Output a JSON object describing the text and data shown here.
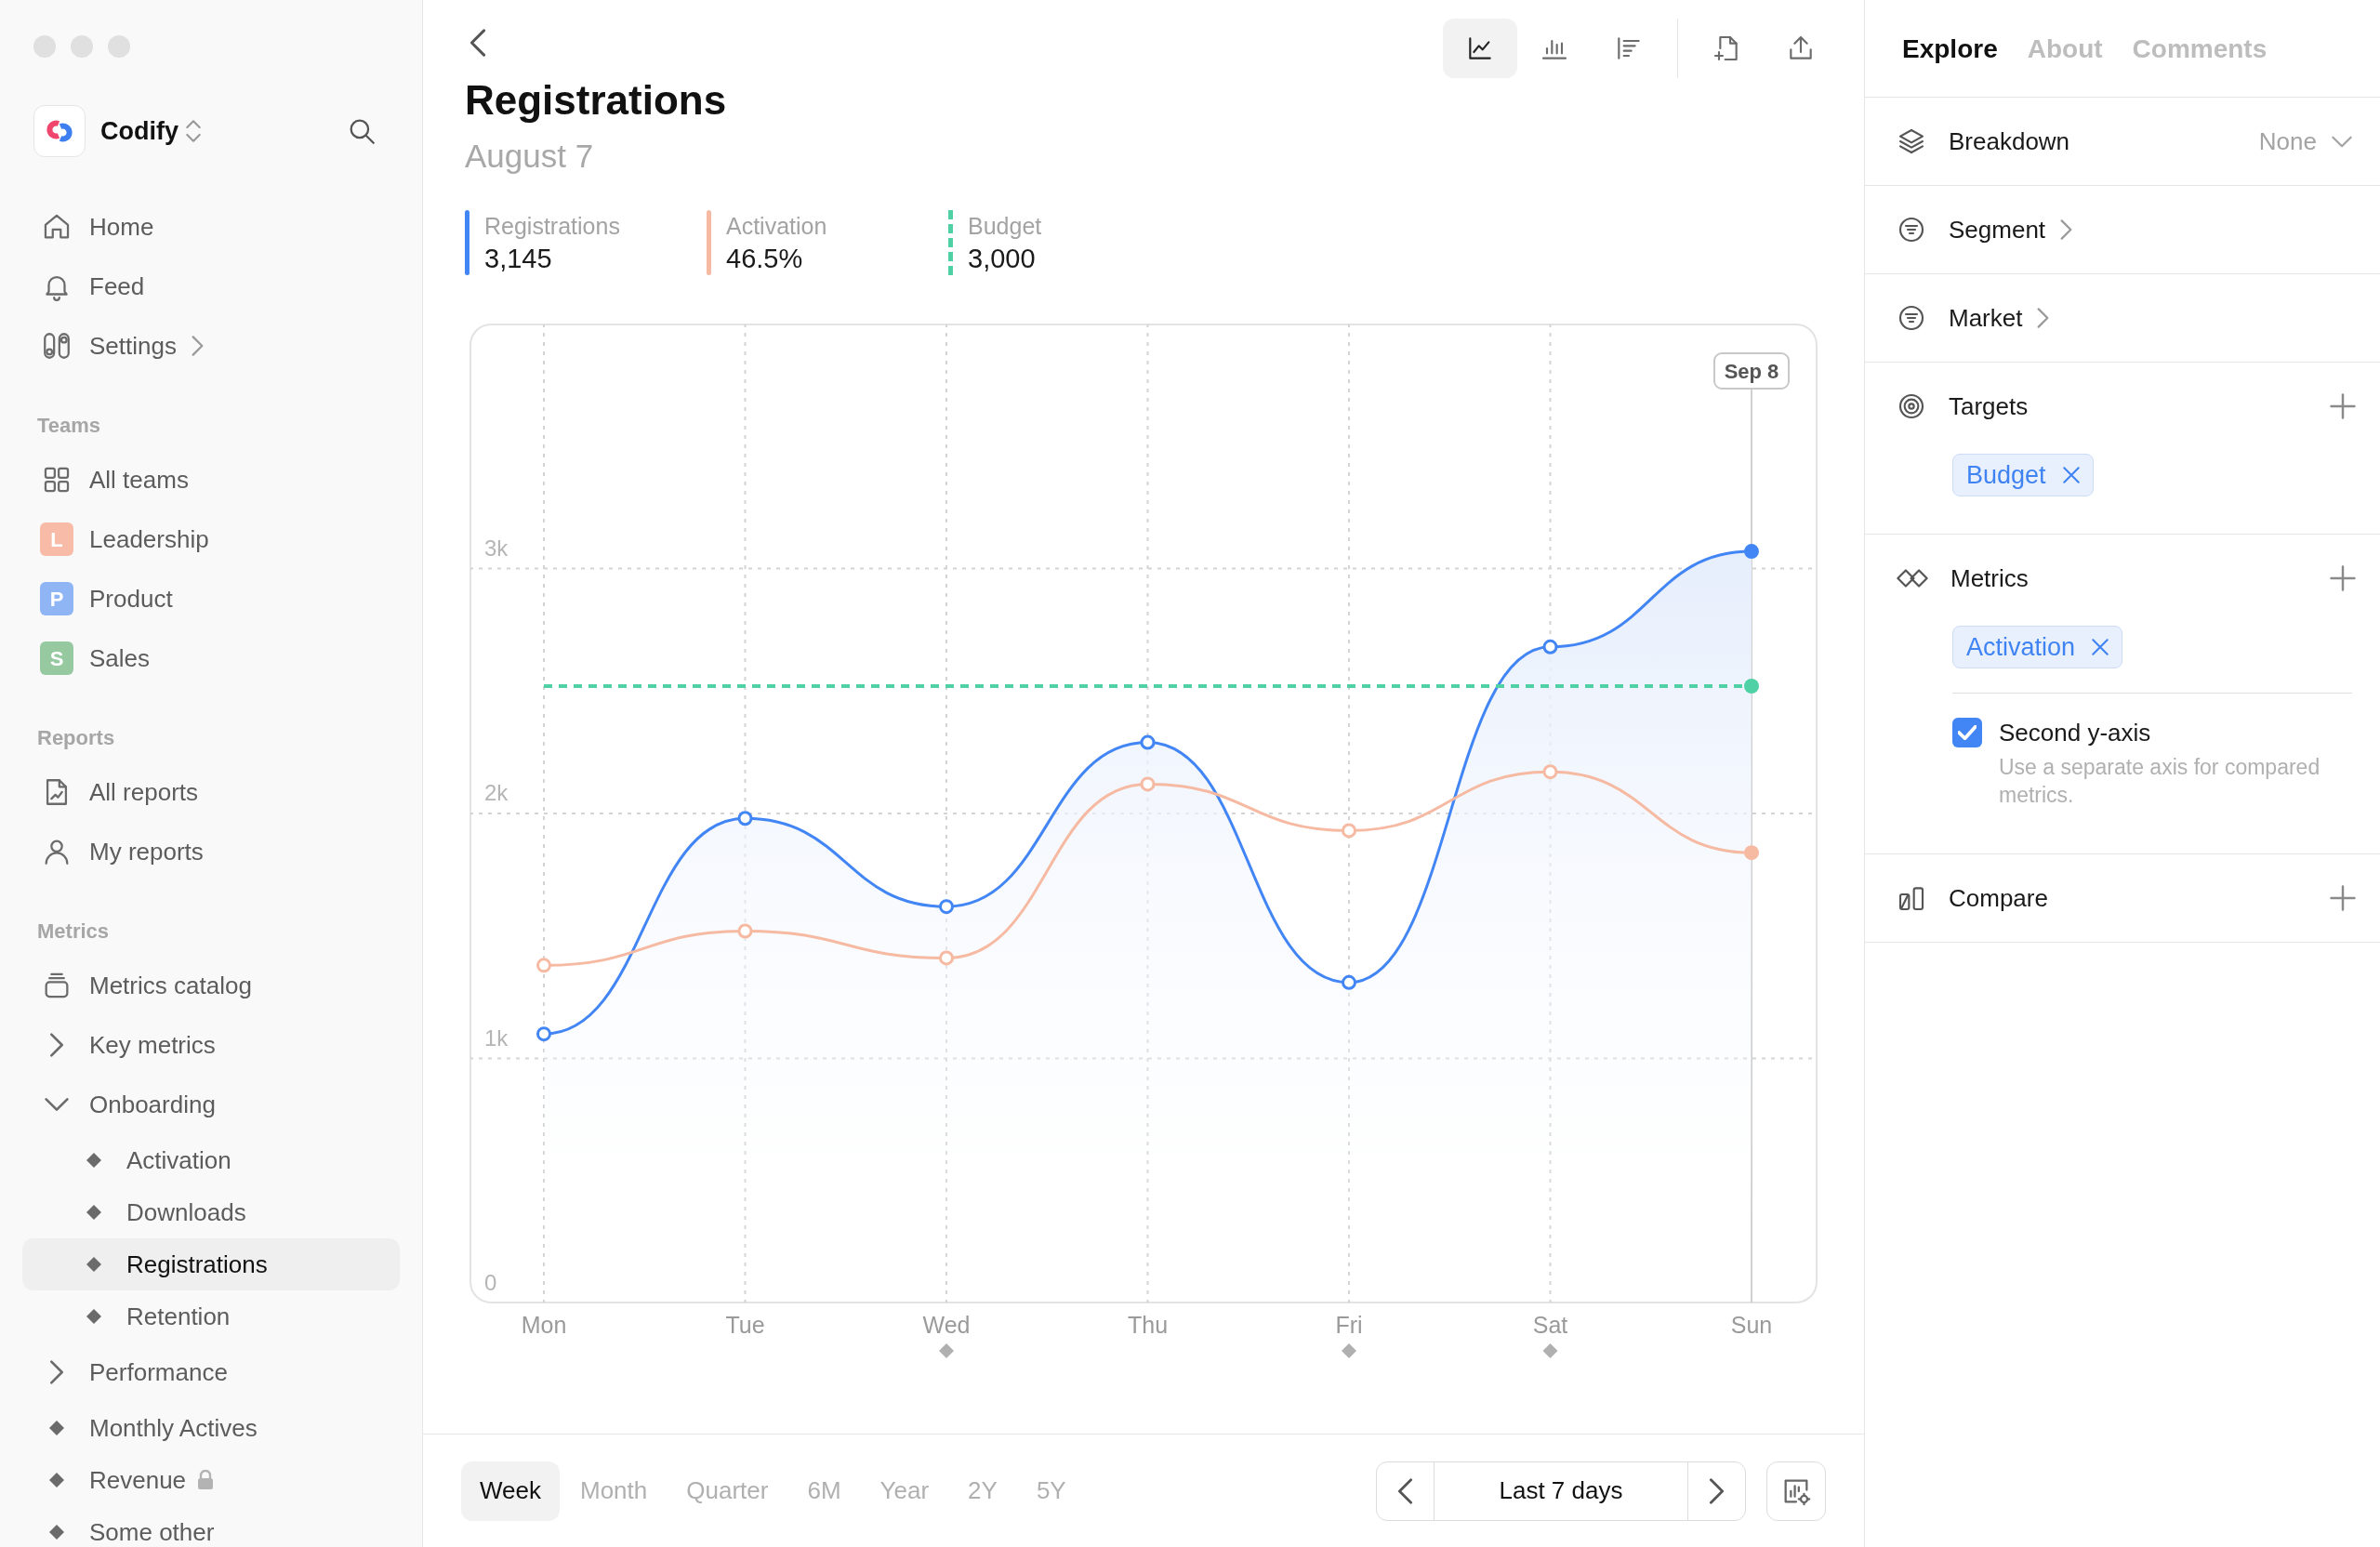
{
  "sidebar": {
    "workspace": {
      "name": "Codify"
    },
    "nav": [
      {
        "label": "Home",
        "kind": "link",
        "selected": false
      },
      {
        "label": "Feed",
        "kind": "link",
        "selected": false
      },
      {
        "label": "Settings",
        "kind": "submenu",
        "selected": false
      }
    ],
    "sections": [
      {
        "title": "Teams",
        "items": [
          {
            "label": "All teams",
            "kind": "link",
            "selected": false
          },
          {
            "label": "Leadership",
            "kind": "team",
            "initial": "L",
            "color": "#f7bba7",
            "selected": false
          },
          {
            "label": "Product",
            "kind": "team",
            "initial": "P",
            "color": "#8fb5f5",
            "selected": false
          },
          {
            "label": "Sales",
            "kind": "team",
            "initial": "S",
            "color": "#96c9a0",
            "selected": false
          }
        ]
      },
      {
        "title": "Reports",
        "items": [
          {
            "label": "All reports",
            "kind": "link",
            "selected": false
          },
          {
            "label": "My reports",
            "kind": "link",
            "selected": false
          }
        ]
      },
      {
        "title": "Metrics",
        "items": [
          {
            "label": "Metrics catalog",
            "kind": "link",
            "selected": false
          },
          {
            "label": "Key metrics",
            "kind": "group",
            "expanded": false,
            "selected": false
          },
          {
            "label": "Onboarding",
            "kind": "group",
            "expanded": true,
            "selected": false,
            "children": [
              {
                "label": "Activation",
                "kind": "metric",
                "selected": false
              },
              {
                "label": "Downloads",
                "kind": "metric",
                "selected": false
              },
              {
                "label": "Registrations",
                "kind": "metric",
                "selected": true
              },
              {
                "label": "Retention",
                "kind": "metric",
                "selected": false
              }
            ]
          },
          {
            "label": "Performance",
            "kind": "group",
            "expanded": false,
            "selected": false
          },
          {
            "label": "Monthly Actives",
            "kind": "metric",
            "selected": false
          },
          {
            "label": "Revenue",
            "kind": "metric",
            "locked": true,
            "selected": false
          },
          {
            "label": "Some other",
            "kind": "metric",
            "selected": false
          }
        ]
      }
    ]
  },
  "header": {
    "title": "Registrations",
    "subtitle": "August 7"
  },
  "toolbar": [
    {
      "kind": "line",
      "selected": true
    },
    {
      "kind": "bars",
      "selected": false
    },
    {
      "kind": "list",
      "selected": false
    },
    {
      "kind": "add",
      "selected": false
    },
    {
      "kind": "share",
      "selected": false
    }
  ],
  "legend": [
    {
      "value": "3,145"
    },
    {
      "value": "46.5%"
    },
    {
      "value": "3,000"
    }
  ],
  "chart": {
    "chart_data": {
      "type": "line",
      "categories": [
        "Mon",
        "Tue",
        "Wed",
        "Thu",
        "Fri",
        "Sat",
        "Sun"
      ],
      "series": [
        {
          "name": "Registrations",
          "type": "area",
          "color": "#4285f4",
          "marker": "circle",
          "values": [
            1100,
            1980,
            1620,
            2290,
            1310,
            2680,
            3070
          ]
        },
        {
          "name": "Activation",
          "type": "line",
          "color": "#f6b9a2",
          "marker": "circle",
          "values": [
            1380,
            1520,
            1410,
            2120,
            1930,
            2170,
            1840
          ]
        },
        {
          "name": "Budget",
          "type": "line",
          "color": "#4fd1a5",
          "line_style": "dashed",
          "values": [
            2520,
            2520,
            2520,
            2520,
            2520,
            2520,
            2520
          ]
        }
      ],
      "ylim": [
        0,
        4000
      ],
      "yticks": [
        {
          "value": 0,
          "label": "0"
        },
        {
          "value": 1000,
          "label": "1k"
        },
        {
          "value": 2000,
          "label": "2k"
        },
        {
          "value": 3000,
          "label": "3k"
        }
      ],
      "grid": true,
      "annotations": [
        {
          "x": "Sun",
          "text": "Sep 8"
        }
      ]
    },
    "event_markers": [
      {
        "marked": false
      },
      {
        "marked": false
      },
      {
        "marked": true
      },
      {
        "marked": false
      },
      {
        "marked": true
      },
      {
        "marked": true
      },
      {
        "marked": false
      }
    ]
  },
  "periods": [
    {
      "label": "Week",
      "selected": true
    },
    {
      "label": "Month",
      "selected": false
    },
    {
      "label": "Quarter",
      "selected": false
    },
    {
      "label": "6M",
      "selected": false
    },
    {
      "label": "Year",
      "selected": false
    },
    {
      "label": "2Y",
      "selected": false
    },
    {
      "label": "5Y",
      "selected": false
    }
  ],
  "range": {
    "label": "Last 7 days"
  },
  "panel": {
    "tabs": [
      {
        "label": "Explore",
        "selected": true
      },
      {
        "label": "About",
        "selected": false
      },
      {
        "label": "Comments",
        "selected": false
      }
    ],
    "sections": [
      {
        "kind": "select",
        "label": "Breakdown",
        "value": "None"
      },
      {
        "kind": "link",
        "label": "Segment"
      },
      {
        "kind": "link",
        "label": "Market"
      },
      {
        "kind": "add",
        "label": "Targets",
        "chips": [
          "Budget"
        ]
      },
      {
        "kind": "add",
        "label": "Metrics",
        "chips": [
          "Activation"
        ],
        "option": {
          "label": "Second y-axis",
          "checked": true,
          "help": "Use a separate axis for compared metrics."
        }
      },
      {
        "kind": "add",
        "label": "Compare"
      }
    ]
  }
}
